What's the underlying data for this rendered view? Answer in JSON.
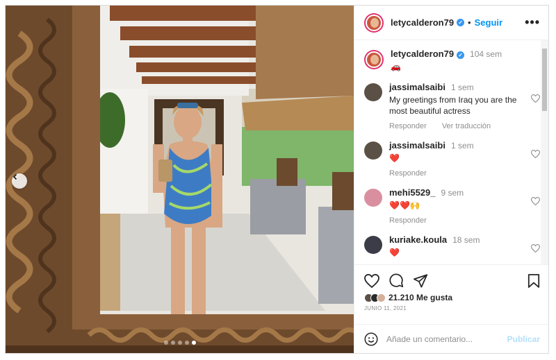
{
  "header": {
    "username": "letycalderon79",
    "separator": "•",
    "follow_label": "Seguir",
    "more_label": "•••"
  },
  "caption": {
    "username": "letycalderon79",
    "time": "104 sem",
    "text": "🚗"
  },
  "comments": [
    {
      "username": "jassimalsaibi",
      "time": "1 sem",
      "text": "My greetings from Iraq you are the most beautiful actress",
      "reply_label": "Responder",
      "translate_label": "Ver traducción"
    },
    {
      "username": "jassimalsaibi",
      "time": "1 sem",
      "text": "❤️",
      "reply_label": "Responder"
    },
    {
      "username": "mehi5529_",
      "time": "9 sem",
      "text": "❤️❤️🙌",
      "reply_label": "Responder"
    },
    {
      "username": "kuriake.koula",
      "time": "18 sem",
      "text": "❤️"
    }
  ],
  "footer": {
    "likes": "21.210 Me gusta",
    "date": "JUNIO 11, 2021",
    "comment_placeholder": "Añade un comentario...",
    "publish_label": "Publicar"
  },
  "carousel": {
    "total": 5,
    "active_index": 4
  },
  "colors": {
    "accent": "#0095f6",
    "publish_disabled": "#b2dffc",
    "verified": "#3897f0",
    "muted": "#8e8e8e"
  },
  "icons": [
    "chevron-left-icon",
    "heart-icon",
    "comment-icon",
    "share-icon",
    "bookmark-icon",
    "emoji-icon",
    "more-icon",
    "verified-icon"
  ]
}
